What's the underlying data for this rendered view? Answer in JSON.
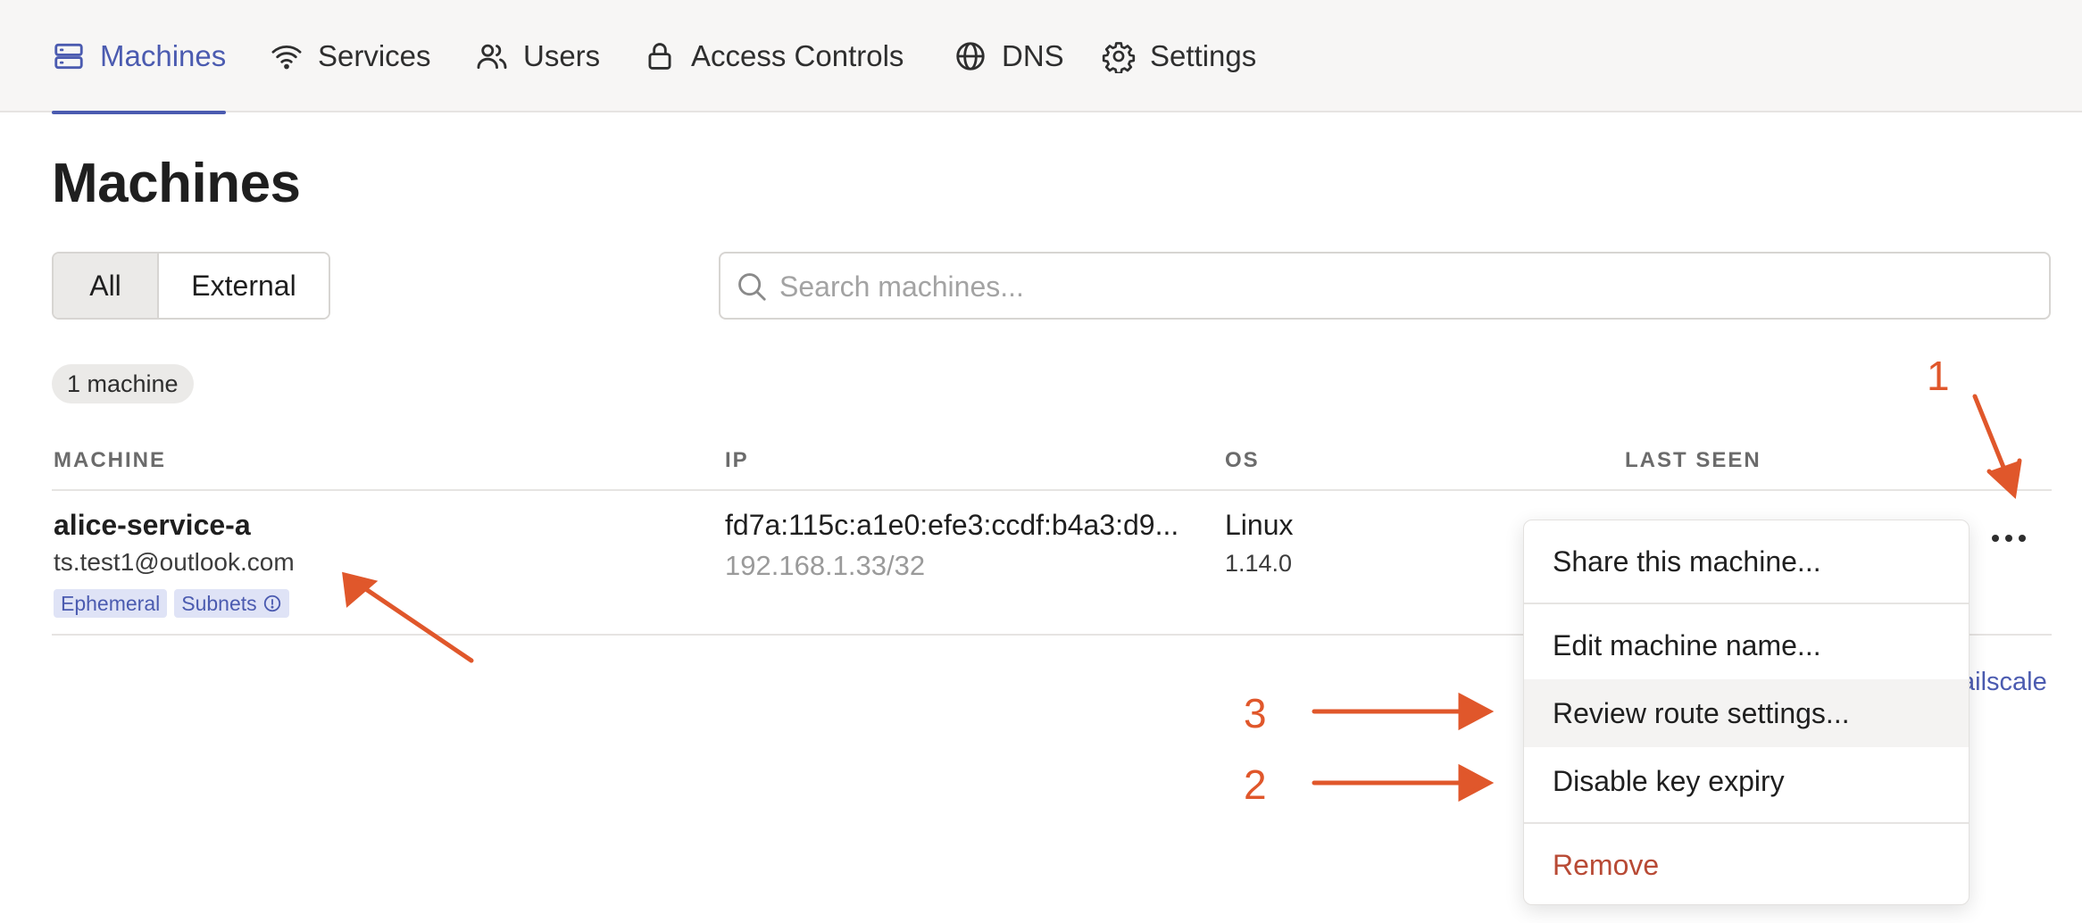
{
  "nav": {
    "items": [
      {
        "label": "Machines",
        "icon": "server-icon",
        "active": true
      },
      {
        "label": "Services",
        "icon": "wifi-icon"
      },
      {
        "label": "Users",
        "icon": "users-icon"
      },
      {
        "label": "Access Controls",
        "icon": "lock-icon"
      },
      {
        "label": "DNS",
        "icon": "globe-icon"
      },
      {
        "label": "Settings",
        "icon": "gear-icon"
      }
    ]
  },
  "page": {
    "title": "Machines"
  },
  "filter": {
    "all_label": "All",
    "external_label": "External",
    "selected": "All"
  },
  "search": {
    "placeholder": "Search machines..."
  },
  "count_label": "1 machine",
  "table": {
    "columns": [
      "MACHINE",
      "IP",
      "OS",
      "LAST SEEN"
    ],
    "rows": [
      {
        "name": "alice-service-a",
        "owner": "ts.test1@outlook.com",
        "tags": [
          "Ephemeral",
          "Subnets"
        ],
        "ip_primary": "fd7a:115c:a1e0:efe3:ccdf:b4a3:d9...",
        "ip_secondary": "192.168.1.33/32",
        "os": "Linux",
        "os_version": "1.14.0"
      }
    ]
  },
  "behind_menu_text": "ailscale",
  "menu": {
    "items": [
      "Share this machine...",
      "Edit machine name...",
      "Review route settings...",
      "Disable key expiry",
      "Remove"
    ],
    "hovered": "Review route settings..."
  },
  "annotations": {
    "one": "1",
    "two": "2",
    "three": "3"
  },
  "colors": {
    "accent": "#4b5bb0",
    "annotation": "#e0572b",
    "danger": "#b84a35",
    "nav_bg": "#f7f6f5",
    "tag_bg": "#dfe3f6"
  }
}
